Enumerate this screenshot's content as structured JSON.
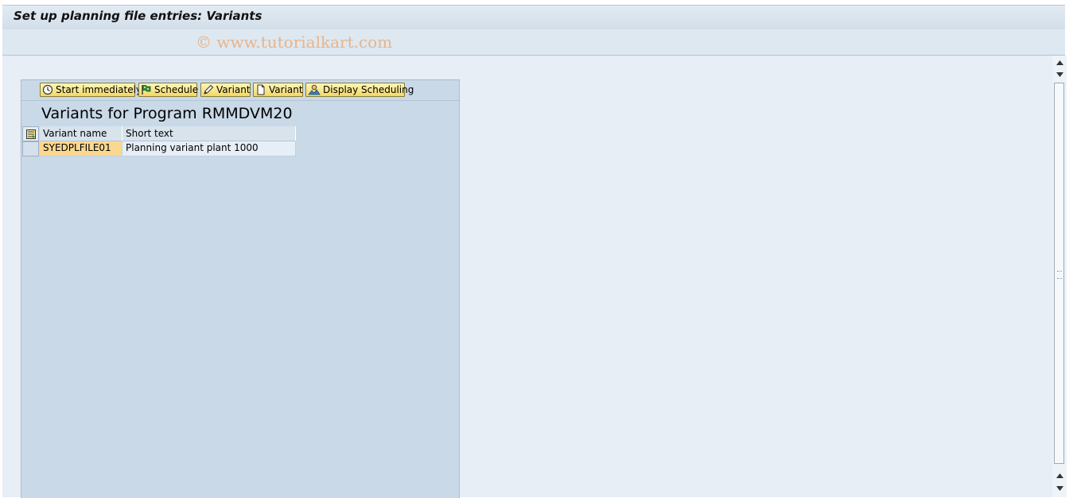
{
  "window": {
    "title": "Set up planning file entries: Variants"
  },
  "watermark": "© www.tutorialkart.com",
  "toolbar": {
    "buttons": [
      {
        "label": "Start immediately",
        "icon": "clock-execute-icon"
      },
      {
        "label": "Schedule",
        "icon": "flag-icon"
      },
      {
        "label": "Variant",
        "icon": "pencil-icon"
      },
      {
        "label": "Variant",
        "icon": "document-icon"
      },
      {
        "label": "Display Scheduling",
        "icon": "person-mountain-icon"
      }
    ]
  },
  "heading": "Variants for Program RMMDVM20",
  "table": {
    "columns": [
      "Variant name",
      "Short text"
    ],
    "rows": [
      [
        "SYEDPLFILE01",
        "Planning variant plant 1000"
      ]
    ]
  },
  "colors": {
    "title_bar": "#d2dee9",
    "panel": "#c9d9e7",
    "button": "#f3d865",
    "key_cell": "#fbd88f",
    "workarea": "#e7eef6",
    "watermark": "#e8b48a"
  }
}
